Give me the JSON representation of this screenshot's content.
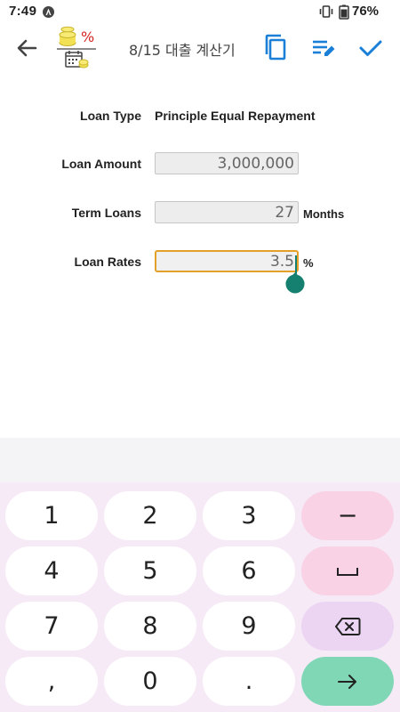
{
  "status_bar": {
    "time": "7:49",
    "battery_percent": "76%"
  },
  "app_bar": {
    "title": "8/15 대출 계산기",
    "logo_symbol": "%"
  },
  "form": {
    "loan_type": {
      "label": "Loan Type",
      "value": "Principle Equal Repayment"
    },
    "loan_amount": {
      "label": "Loan Amount",
      "value": "3,000,000"
    },
    "term_loans": {
      "label": "Term Loans",
      "value": "27",
      "unit": "Months"
    },
    "loan_rates": {
      "label": "Loan Rates",
      "value": "3.5",
      "unit": "%"
    }
  },
  "keyboard": {
    "row1": [
      "1",
      "2",
      "3",
      "−"
    ],
    "row2": [
      "4",
      "5",
      "6",
      "␣"
    ],
    "row3": [
      "7",
      "8",
      "9",
      "backspace-icon"
    ],
    "row4": [
      ",",
      "0",
      ".",
      "enter-arrow-icon"
    ],
    "colors": {
      "key": "#ffffff",
      "pink": "#f9d2e6",
      "lavender": "#ecd4f3",
      "teal": "#7fd7b6",
      "background": "#f6eaf6"
    }
  },
  "colors": {
    "accent": "#1a7fd6",
    "focus_border": "#e3a12a",
    "cursor": "#15806f"
  }
}
